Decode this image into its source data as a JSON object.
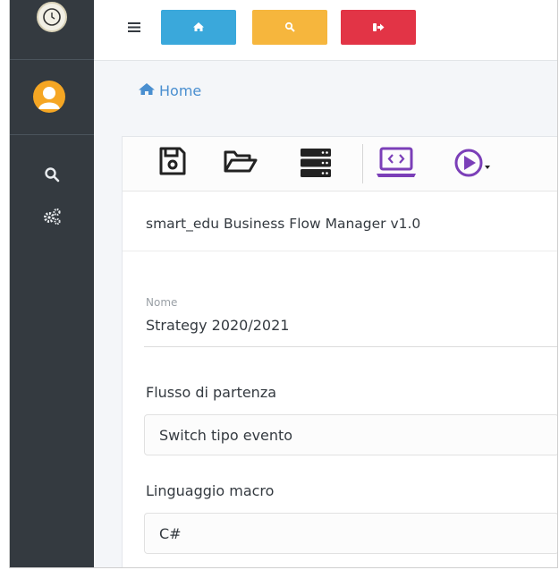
{
  "sidebar": {
    "logo_icon": "clock-logo-icon",
    "avatar_icon": "user-avatar-icon",
    "items": [
      {
        "icon": "search-icon"
      },
      {
        "icon": "gears-icon"
      }
    ]
  },
  "navbar": {
    "menu_icon": "hamburger-icon",
    "buttons": [
      {
        "icon": "home-icon",
        "color": "#3aa8db"
      },
      {
        "icon": "search-icon",
        "color": "#f6b63d"
      },
      {
        "icon": "sign-out-icon",
        "color": "#e23446"
      }
    ]
  },
  "breadcrumb": {
    "icon": "home-icon",
    "label": "Home"
  },
  "toolbar": {
    "tools": [
      {
        "icon": "save-icon"
      },
      {
        "icon": "folder-open-icon"
      },
      {
        "icon": "server-icon"
      },
      {
        "icon": "code-laptop-icon",
        "color": "#7b3fb8"
      },
      {
        "icon": "play-dropdown-icon",
        "color": "#7b3fb8"
      }
    ]
  },
  "form": {
    "app_title": "smart_edu Business Flow Manager v1.0",
    "name_label": "Nome",
    "name_value": "Strategy 2020/2021",
    "start_flow_label": "Flusso di partenza",
    "start_flow_value": "Switch tipo evento",
    "macro_lang_label": "Linguaggio macro",
    "macro_lang_value": "C#"
  }
}
